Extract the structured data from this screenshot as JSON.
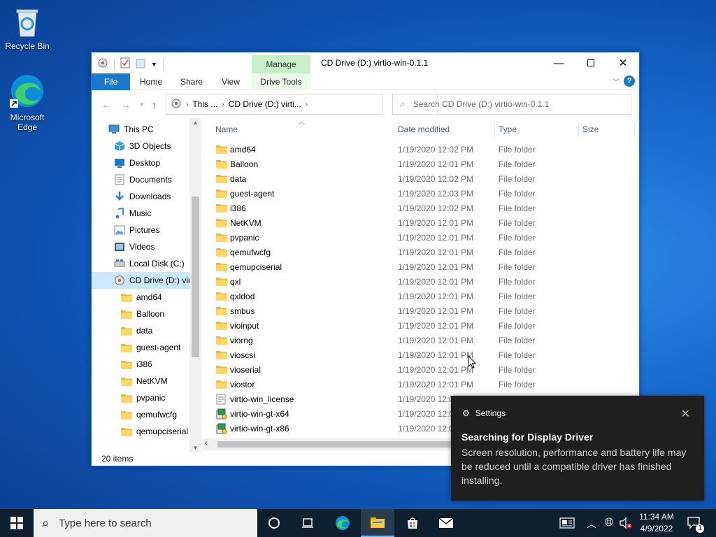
{
  "desktop": {
    "icons": [
      {
        "label": "Recycle Bin"
      },
      {
        "label": "Microsoft Edge"
      }
    ]
  },
  "explorer": {
    "title": "CD Drive (D:) virtio-win-0.1.1",
    "manage_tab": "Manage",
    "ribbon_tabs": {
      "file": "File",
      "home": "Home",
      "share": "Share",
      "view": "View",
      "drive_tools": "Drive Tools"
    },
    "address": {
      "seg1": "This ...",
      "seg2": "CD Drive (D:) virti..."
    },
    "search_placeholder": "Search CD Drive (D:) virtio-win-0.1.1",
    "columns": {
      "name": "Name",
      "date": "Date modified",
      "type": "Type",
      "size": "Size"
    },
    "nav_tree": [
      {
        "label": "This PC",
        "icon": "pc-icon"
      },
      {
        "label": "3D Objects",
        "icon": "3d-objects-icon"
      },
      {
        "label": "Desktop",
        "icon": "desktop-icon"
      },
      {
        "label": "Documents",
        "icon": "documents-icon"
      },
      {
        "label": "Downloads",
        "icon": "downloads-icon"
      },
      {
        "label": "Music",
        "icon": "music-icon"
      },
      {
        "label": "Pictures",
        "icon": "pictures-icon"
      },
      {
        "label": "Videos",
        "icon": "videos-icon"
      },
      {
        "label": "Local Disk (C:)",
        "icon": "local-disk-icon"
      },
      {
        "label": "CD Drive (D:) virt",
        "icon": "cd-drive-icon"
      },
      {
        "label": "amd64",
        "icon": "folder-icon"
      },
      {
        "label": "Balloon",
        "icon": "folder-icon"
      },
      {
        "label": "data",
        "icon": "folder-icon"
      },
      {
        "label": "guest-agent",
        "icon": "folder-icon"
      },
      {
        "label": "i386",
        "icon": "folder-icon"
      },
      {
        "label": "NetKVM",
        "icon": "folder-icon"
      },
      {
        "label": "pvpanic",
        "icon": "folder-icon"
      },
      {
        "label": "qemufwcfg",
        "icon": "folder-icon"
      },
      {
        "label": "qemupciserial",
        "icon": "folder-icon"
      }
    ],
    "files": [
      {
        "name": "amd64",
        "date": "1/19/2020 12:02 PM",
        "type": "File folder",
        "kind": "folder"
      },
      {
        "name": "Balloon",
        "date": "1/19/2020 12:01 PM",
        "type": "File folder",
        "kind": "folder"
      },
      {
        "name": "data",
        "date": "1/19/2020 12:02 PM",
        "type": "File folder",
        "kind": "folder"
      },
      {
        "name": "guest-agent",
        "date": "1/19/2020 12:03 PM",
        "type": "File folder",
        "kind": "folder"
      },
      {
        "name": "i386",
        "date": "1/19/2020 12:02 PM",
        "type": "File folder",
        "kind": "folder"
      },
      {
        "name": "NetKVM",
        "date": "1/19/2020 12:01 PM",
        "type": "File folder",
        "kind": "folder"
      },
      {
        "name": "pvpanic",
        "date": "1/19/2020 12:01 PM",
        "type": "File folder",
        "kind": "folder"
      },
      {
        "name": "qemufwcfg",
        "date": "1/19/2020 12:01 PM",
        "type": "File folder",
        "kind": "folder"
      },
      {
        "name": "qemupciserial",
        "date": "1/19/2020 12:01 PM",
        "type": "File folder",
        "kind": "folder"
      },
      {
        "name": "qxl",
        "date": "1/19/2020 12:01 PM",
        "type": "File folder",
        "kind": "folder"
      },
      {
        "name": "qxldod",
        "date": "1/19/2020 12:01 PM",
        "type": "File folder",
        "kind": "folder"
      },
      {
        "name": "smbus",
        "date": "1/19/2020 12:01 PM",
        "type": "File folder",
        "kind": "folder"
      },
      {
        "name": "vioinput",
        "date": "1/19/2020 12:01 PM",
        "type": "File folder",
        "kind": "folder"
      },
      {
        "name": "viorng",
        "date": "1/19/2020 12:01 PM",
        "type": "File folder",
        "kind": "folder"
      },
      {
        "name": "vioscsi",
        "date": "1/19/2020 12:01 PM",
        "type": "File folder",
        "kind": "folder"
      },
      {
        "name": "vioserial",
        "date": "1/19/2020 12:01 PM",
        "type": "File folder",
        "kind": "folder"
      },
      {
        "name": "viostor",
        "date": "1/19/2020 12:01 PM",
        "type": "File folder",
        "kind": "folder"
      },
      {
        "name": "virtio-win_license",
        "date": "1/19/2020 12:0",
        "type": "",
        "kind": "text"
      },
      {
        "name": "virtio-win-gt-x64",
        "date": "1/19/2020 12:0",
        "type": "",
        "kind": "installer"
      },
      {
        "name": "virtio-win-gt-x86",
        "date": "1/19/2020 12:0",
        "type": "",
        "kind": "installer"
      }
    ],
    "status": "20 items"
  },
  "toast": {
    "app": "Settings",
    "title": "Searching for Display Driver",
    "message": "Screen resolution, performance and battery life may be reduced until a compatible driver has finished installing."
  },
  "taskbar": {
    "search_placeholder": "Type here to search",
    "time": "11:34 AM",
    "date": "4/9/2022",
    "notification_count": "1"
  },
  "colors": {
    "accent": "#1979ca",
    "selection": "#cce8ff",
    "folder": "#ffd766",
    "taskbar": "#0e1f2f"
  }
}
